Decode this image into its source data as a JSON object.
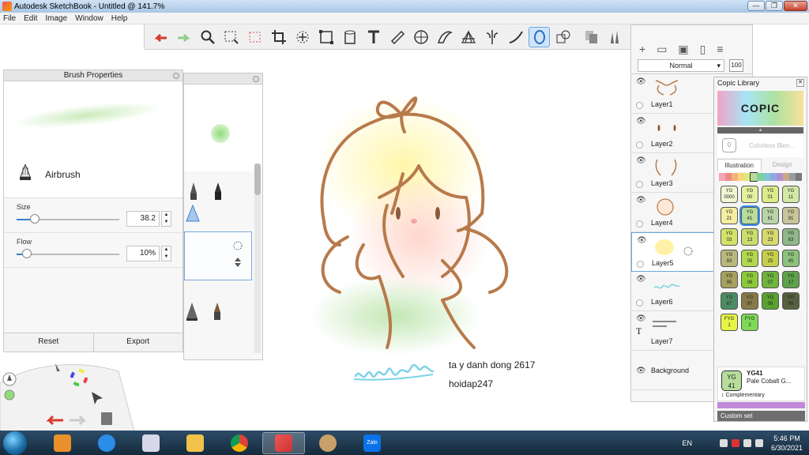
{
  "window": {
    "title": "Autodesk SketchBook - Untitled @ 141.7%",
    "min": "—",
    "max": "❐",
    "close": "✕"
  },
  "menu": [
    "File",
    "Edit",
    "Image",
    "Window",
    "Help"
  ],
  "toolbar": {
    "tools": [
      "undo",
      "redo",
      "zoom",
      "select-rectangle",
      "select-lasso",
      "crop",
      "transform",
      "distort",
      "fill",
      "text",
      "ruler",
      "ellipse-guide",
      "french-curve",
      "perspective",
      "symmetry",
      "stroke-steady",
      "predictive-stroke",
      "copy-paste"
    ],
    "active_tool": "predictive-stroke"
  },
  "brush_properties": {
    "title": "Brush Properties",
    "brush_name": "Airbrush",
    "size_label": "Size",
    "size_value": "38.2",
    "size_fraction": 0.18,
    "flow_label": "Flow",
    "flow_value": "10%",
    "flow_fraction": 0.1,
    "reset_label": "Reset",
    "export_label": "Export"
  },
  "canvas": {
    "caption_line1": "ta y danh dong 2617",
    "caption_line2": "hoidap247"
  },
  "layers": {
    "blend_mode": "Normal",
    "opacity": "100",
    "items": [
      {
        "name": "Layer1"
      },
      {
        "name": "Layer2"
      },
      {
        "name": "Layer3"
      },
      {
        "name": "Layer4"
      },
      {
        "name": "Layer5",
        "selected": true
      },
      {
        "name": "Layer6"
      },
      {
        "name": "Layer7"
      },
      {
        "name": "Background"
      }
    ]
  },
  "copic": {
    "title": "Copic Library",
    "logo": "COPIC",
    "colorless_code": "0",
    "colorless_name": "Colorless Blen...",
    "tab_illustration": "Illustration",
    "tab_design": "Design",
    "chips": [
      {
        "code": "YG\n0000",
        "color": "#f2f7d2"
      },
      {
        "code": "YG\n00",
        "color": "#e5f0a0"
      },
      {
        "code": "YG\n01",
        "color": "#dcec8a"
      },
      {
        "code": "YG\n11",
        "color": "#d3e8a4"
      },
      {
        "code": "YG\n21",
        "color": "#f4ee9e"
      },
      {
        "code": "YG\n41",
        "color": "#b7dc9c"
      },
      {
        "code": "YG\n61",
        "color": "#b8d4a8"
      },
      {
        "code": "YG\n91",
        "color": "#c9c59a"
      },
      {
        "code": "YG\n03",
        "color": "#d3e36a"
      },
      {
        "code": "YG\n13",
        "color": "#c9de6e"
      },
      {
        "code": "YG\n23",
        "color": "#d5d96e"
      },
      {
        "code": "YG\n63",
        "color": "#8fb888"
      },
      {
        "code": "YG\n93",
        "color": "#b8b87c"
      },
      {
        "code": "YG\n05",
        "color": "#b2d84e"
      },
      {
        "code": "YG\n25",
        "color": "#c6cf4c"
      },
      {
        "code": "YG\n45",
        "color": "#8bc37a"
      },
      {
        "code": "YG\n95",
        "color": "#a7a05e"
      },
      {
        "code": "YG\n06",
        "color": "#8cc93a"
      },
      {
        "code": "YG\n07",
        "color": "#6fb43c"
      },
      {
        "code": "YG\n17",
        "color": "#5ea14a"
      },
      {
        "code": "YG\n67",
        "color": "#4d8c63"
      },
      {
        "code": "YG\n97",
        "color": "#877a48"
      },
      {
        "code": "YG\n09",
        "color": "#5aa230"
      },
      {
        "code": "YG\n99",
        "color": "#56603e"
      },
      {
        "code": "FYG\n1",
        "color": "#e6f545"
      },
      {
        "code": "FYG\n2",
        "color": "#7ed957"
      }
    ],
    "selected_chip": 5,
    "current_code": "YG41",
    "current_chip": "YG\n41",
    "current_name": "Pale Cobalt G...",
    "complementary": "↕ Complementary",
    "custom_set": "Custom set"
  },
  "taskbar": {
    "language": "EN",
    "time": "5:46 PM",
    "date": "6/30/2021",
    "apps": [
      "media-player",
      "internet-explorer",
      "snipping-tool",
      "file-explorer",
      "chrome",
      "sketchbook",
      "paint",
      "zalo"
    ],
    "zalo_label": "Zalo"
  },
  "colors": {
    "accent": "#6aa6df",
    "taskbar": "#1c3347",
    "sketch_line": "#b87a4b"
  }
}
